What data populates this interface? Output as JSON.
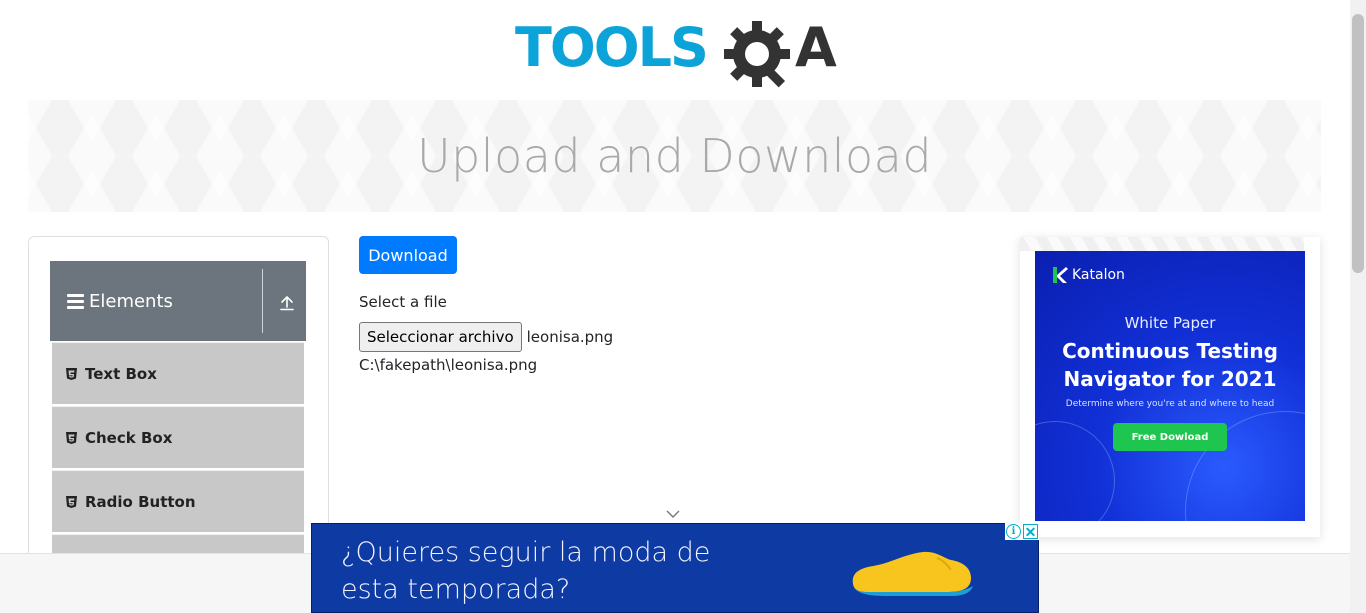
{
  "logo": {
    "text_left": "TOOLS",
    "text_right": "A",
    "colors": {
      "blue": "#0ca3d9",
      "dark": "#333333"
    }
  },
  "banner": {
    "title": "Upload and Download"
  },
  "sidebar": {
    "group": {
      "title": "Elements",
      "icon": "hamburger-icon",
      "toggle_icon": "upload-arrow-icon"
    },
    "items": [
      {
        "label": "Text Box"
      },
      {
        "label": "Check Box"
      },
      {
        "label": "Radio Button"
      }
    ]
  },
  "main": {
    "download_label": "Download",
    "select_label": "Select a file",
    "file_button_label": "Seleccionar archivo",
    "file_name": "leonisa.png",
    "file_path": "C:\\fakepath\\leonisa.png"
  },
  "right_ad": {
    "brand": "Katalon",
    "subtitle": "White Paper",
    "title_line1": "Continuous Testing",
    "title_line2": "Navigator for 2021",
    "description": "Determine where you're at and where to head",
    "cta": "Free Dowload"
  },
  "bottom_ad": {
    "text": "¿Quieres seguir la moda de esta temporada?",
    "info_glyph": "i",
    "close_glyph": "✕"
  },
  "colors": {
    "primary": "#007bff",
    "sidebar_header": "#6c757d",
    "menu_item": "#c8c8c8",
    "ad_blue": "#0d3aa3",
    "cta_green": "#1ec54f"
  }
}
